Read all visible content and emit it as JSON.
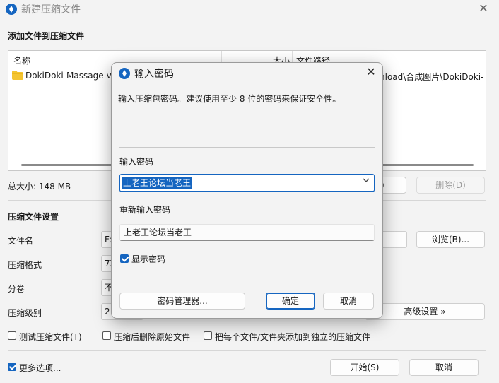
{
  "window": {
    "title": "新建压缩文件",
    "close_glyph": "✕"
  },
  "add_section": {
    "title": "添加文件到压缩文件",
    "columns": {
      "name": "名称",
      "size": "大小",
      "path": "文件路径"
    },
    "rows": [
      {
        "name": "DokiDoki-Massage-v",
        "path": "nload\\合成图片\\DokiDoki-",
        "icon": "folder-icon"
      }
    ],
    "total_size": "总大小: 148 MB",
    "add_btn_partial": ")",
    "delete_label": "删除(D)"
  },
  "settings": {
    "title": "压缩文件设置",
    "filename_label": "文件名",
    "filename_value": "F:\\",
    "format_label": "压缩格式",
    "format_value": "7Z",
    "split_label": "分卷",
    "split_value": "不",
    "level_label": "压缩级别",
    "level_value": "2-",
    "browse_label": "浏览(B)...",
    "advanced_label": "高级设置 »",
    "test_label": "测试压缩文件(T)",
    "delete_after_label": "压缩后删除原始文件",
    "separate_label": "把每个文件/文件夹添加到独立的压缩文件"
  },
  "footer": {
    "more_options_label": "更多选项...",
    "start_label": "开始(S)",
    "cancel_label": "取消"
  },
  "dialog": {
    "title": "输入密码",
    "close_glyph": "✕",
    "hint": "输入压缩包密码。建议使用至少 8 位的密码来保证安全性。",
    "password_label": "输入密码",
    "password_value": "上老王论坛当老王",
    "confirm_label": "重新输入密码",
    "confirm_value": "上老王论坛当老王",
    "show_password_label": "显示密码",
    "manager_label": "密码管理器...",
    "ok_label": "确定",
    "cancel_label": "取消"
  },
  "colors": {
    "accent": "#1565c0",
    "window_bg": "#f3f3f3",
    "folder": "#f4c430"
  }
}
